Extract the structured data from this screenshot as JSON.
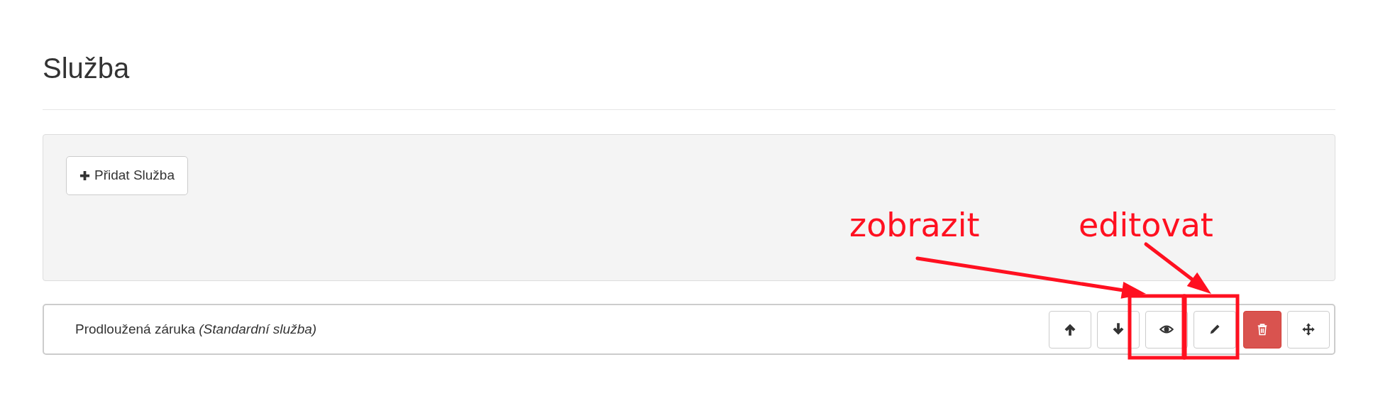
{
  "heading": "Služba",
  "add_button": {
    "label": "Přidat Služba"
  },
  "items": [
    {
      "title": "Prodloužená záruka *(Standardní služba)*",
      "actions": [
        {
          "kind": "up"
        },
        {
          "kind": "down"
        },
        {
          "kind": "view"
        },
        {
          "kind": "edit"
        },
        {
          "kind": "delete"
        },
        {
          "kind": "move"
        }
      ]
    }
  ],
  "annotations": [
    {
      "text": "zobrazit"
    },
    {
      "text": "editovat"
    }
  ]
}
